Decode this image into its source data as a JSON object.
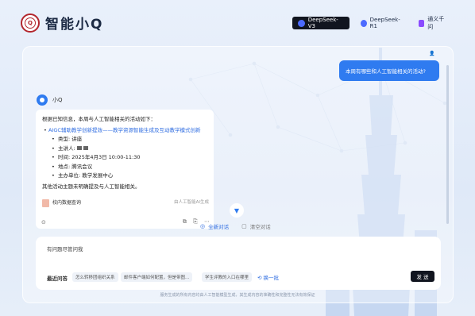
{
  "header": {
    "logo_text": "智能小Q",
    "models": [
      {
        "label": "DeepSeek-V3",
        "icon": "deepseek-icon",
        "active": true
      },
      {
        "label": "DeepSeek-R1",
        "icon": "deepseek-icon",
        "active": false
      },
      {
        "label": "通义千问",
        "icon": "tongyi-icon",
        "active": false
      }
    ]
  },
  "chat": {
    "user_message": "本周有哪些和人工智能相关的活动?",
    "bot_name": "小Q",
    "answer": {
      "intro": "根据已知信息，本周与人工智能相关的活动如下：",
      "event_title": "AIGC辅助教学创新提效——教学资源智能生成及互动教学模式创新",
      "details": [
        {
          "label": "类型:",
          "value": "讲座"
        },
        {
          "label": "主讲人:",
          "value": ""
        },
        {
          "label": "时间:",
          "value": "2025年4月3日 10:00-11:30"
        },
        {
          "label": "地点:",
          "value": "腾讯会议"
        },
        {
          "label": "主办单位:",
          "value": "教学发展中心"
        }
      ],
      "outro": "其他活动主题未明确提及与人工智能相关。",
      "source_label": "校内数据查询",
      "ai_generated_note": "由人工智能AI生成"
    }
  },
  "tools": {
    "new_chat": "全新对话",
    "clear_chat": "清空对话"
  },
  "input": {
    "placeholder": "有问题尽管问我",
    "faq_label": "最近问答",
    "faqs": [
      "怎么转移团组织关系",
      "邮件客户端如何配置，但是带图...",
      "学生评教的入口在哪里"
    ],
    "refresh_label": "换一批",
    "send_label": "发 送"
  },
  "footer": "服务生成的所有内容均由人工智能模型生成，其生成内容的准确性和完整性无法有效保证",
  "colors": {
    "accent": "#2f7bf0",
    "dark": "#11151f"
  }
}
